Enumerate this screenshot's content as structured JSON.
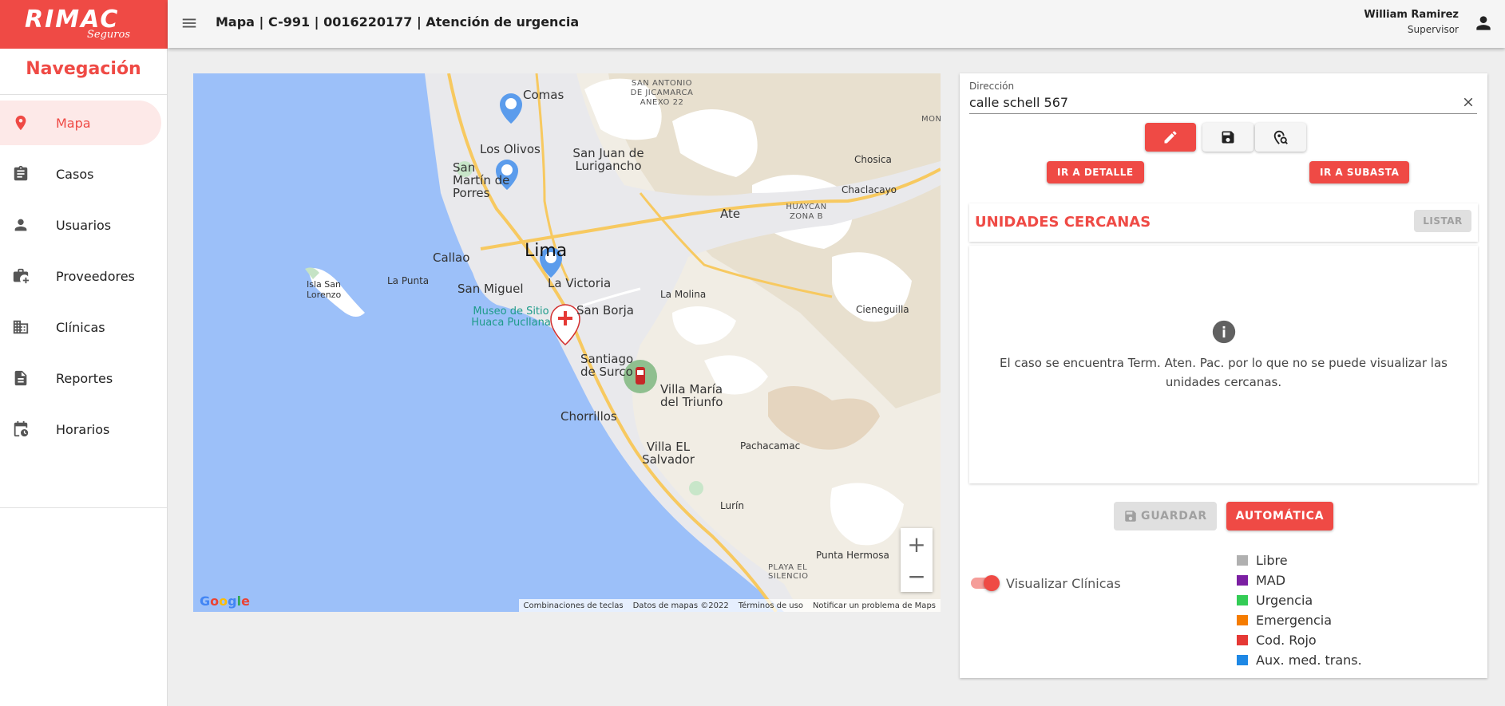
{
  "brand": {
    "name": "RIMAC",
    "sub": "Seguros",
    "color": "#ef4a45"
  },
  "nav": {
    "title": "Navegación",
    "items": [
      {
        "label": "Mapa",
        "icon": "map-pin-icon",
        "active": true
      },
      {
        "label": "Casos",
        "icon": "clipboard-icon"
      },
      {
        "label": "Usuarios",
        "icon": "person-icon"
      },
      {
        "label": "Proveedores",
        "icon": "briefcase-plus-icon"
      },
      {
        "label": "Clínicas",
        "icon": "building-icon"
      },
      {
        "label": "Reportes",
        "icon": "document-icon"
      },
      {
        "label": "Horarios",
        "icon": "calendar-clock-icon"
      }
    ]
  },
  "header": {
    "title": "Mapa | C-991 | 0016220177 | Atención de urgencia",
    "user_name": "William Ramirez",
    "user_role": "Supervisor"
  },
  "map": {
    "labels": {
      "comas": "Comas",
      "los_olivos": "Los Olivos",
      "sjl": "San Juan de Lurigancho",
      "smp": "San Martín de Porres",
      "ate": "Ate",
      "chosica": "Chosica",
      "chaclacayo": "Chaclacayo",
      "huaycan": "HUAYCAN ZONA B",
      "san_antonio": "SAN ANTONIO DE JICAMARCA ANEXO 22",
      "callao": "Callao",
      "lima": "Lima",
      "la_victoria": "La Victoria",
      "la_punta": "La Punta",
      "isla": "Isla San Lorenzo",
      "san_miguel": "San Miguel",
      "la_molina": "La Molina",
      "cieneguilla": "Cieneguilla",
      "museo": "Museo de Sitio Huaca Pucllana",
      "san_borja": "San Borja",
      "surco": "Santiago de Surco",
      "vmt": "Villa María del Triunfo",
      "chorrillos": "Chorrillos",
      "pachacamac": "Pachacamac",
      "ves": "Villa EL Salvador",
      "lurin": "Lurín",
      "punta_hermosa": "Punta Hermosa",
      "playa": "PLAYA EL SILENCIO",
      "mon": "MON"
    },
    "google": "Google",
    "footer": [
      "Combinaciones de teclas",
      "Datos de mapas ©2022",
      "Términos de uso",
      "Notificar un problema de Maps"
    ],
    "zoom_in": "+",
    "zoom_out": "−"
  },
  "panel": {
    "address_label": "Dirección",
    "address_value": "calle schell 567",
    "btn_detail": "IR A DETALLE",
    "btn_auction": "IR A SUBASTA",
    "units_title": "UNIDADES CERCANAS",
    "btn_list": "LISTAR",
    "info_message": "El caso se encuentra Term. Aten. Pac. por lo que no se puede visualizar las unidades cercanas.",
    "btn_save": "GUARDAR",
    "btn_auto": "AUTOMÁTICA",
    "toggle_label": "Visualizar Clínicas",
    "toggle_on": true,
    "legend": [
      {
        "label": "Libre",
        "color": "#b0b0b0"
      },
      {
        "label": "MAD",
        "color": "#7b1fa2"
      },
      {
        "label": "Urgencia",
        "color": "#33cc55"
      },
      {
        "label": "Emergencia",
        "color": "#f57c00"
      },
      {
        "label": "Cod. Rojo",
        "color": "#e53935"
      },
      {
        "label": "Aux. med. trans.",
        "color": "#1e88e5"
      }
    ]
  }
}
